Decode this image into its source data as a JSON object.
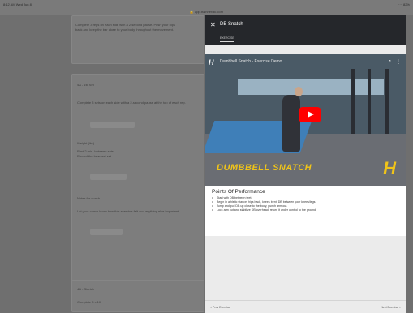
{
  "status_bar": {
    "time": "8:12 AM  Wed Jun 8",
    "signal": "···",
    "battery": "82%"
  },
  "url_bar": {
    "url": "🔒 app.trainheroic.com"
  },
  "background": {
    "card1": {
      "line1": "Complete 3 reps on each side with a 2-second pause. Push your hips",
      "line2": "back and keep the bar close to your body throughout the movement."
    },
    "card2": {
      "title": "4A - 1st Set",
      "note": "Complete 3 sets on each side with a 2-second pause at the top of each rep.",
      "field1_label": "Weight (lbs)",
      "field1_hint": "Rest 2 min. between sets",
      "field1_subhint": "Record the heaviest set",
      "field2_label": "Reps",
      "field3_label": "Notes for coach",
      "field3_hint": "Let your coach know how this exercise felt and anything else important."
    },
    "card3": {
      "title": "4B - Stretch",
      "subtitle": "Complete 3 x 10"
    }
  },
  "drawer": {
    "close_glyph": "✕",
    "title": "DB Snatch",
    "tab": "EXERCISE",
    "video": {
      "logo": "H",
      "title": "Dumbbell Snatch - Exercise Demo",
      "share_glyph": "↗",
      "menu_glyph": "⋮",
      "caption": "DUMBBELL SNATCH",
      "brand_logo": "H"
    },
    "points": {
      "title": "Points Of Performance",
      "items": [
        "Start with DB between feet.",
        "Begin in athletic stance; hips back, knees bent, DB between your knees/legs.",
        "Jump and pull DB up close to the body, punch arm out.",
        "Lock arm out and stabilize DB overhead, return it under control to the ground."
      ]
    },
    "footer": {
      "left": "< Prev Exercise",
      "right": "Next Exercise >"
    }
  }
}
